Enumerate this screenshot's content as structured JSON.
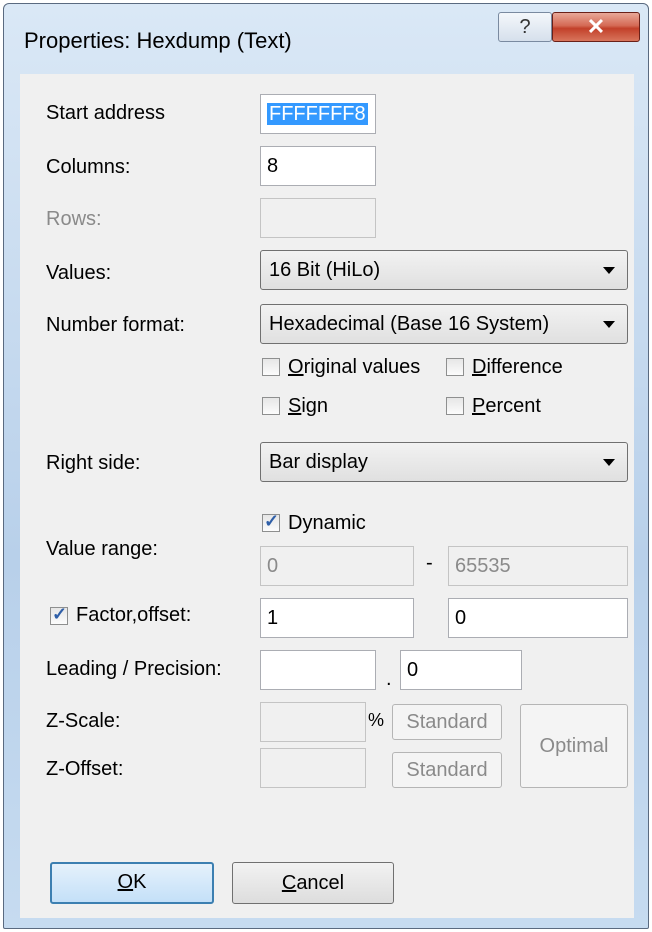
{
  "window": {
    "title": "Properties: Hexdump (Text)",
    "help_glyph": "?",
    "close_glyph": "✕"
  },
  "fields": {
    "start_address": {
      "label": "Start address",
      "value": "FFFFFFF8"
    },
    "columns": {
      "label": "Columns:",
      "value": "8"
    },
    "rows": {
      "label": "Rows:",
      "value": ""
    },
    "values": {
      "label": "Values:",
      "selected": "16 Bit (HiLo)"
    },
    "number_format": {
      "label": "Number format:",
      "selected": "Hexadecimal  (Base 16 System)"
    }
  },
  "checkboxes": {
    "original_values": {
      "hotkey": "O",
      "rest": "riginal values",
      "checked": false
    },
    "difference": {
      "hotkey": "D",
      "rest": "ifference",
      "checked": false
    },
    "sign": {
      "hotkey": "S",
      "rest": "ign",
      "checked": false
    },
    "percent": {
      "hotkey": "P",
      "rest": "ercent",
      "checked": false
    }
  },
  "right_side": {
    "label": "Right side:",
    "selected": "Bar display"
  },
  "value_range": {
    "label": "Value range:",
    "dynamic_label": "Dynamic",
    "dynamic_checked": true,
    "min": "0",
    "separator": "-",
    "max": "65535"
  },
  "factor_offset": {
    "label": "Factor,offset:",
    "checked": true,
    "factor": "1",
    "offset": "0"
  },
  "leading_precision": {
    "label": "Leading / Precision:",
    "leading": "",
    "separator": ".",
    "precision": "0"
  },
  "z_scale": {
    "label": "Z-Scale:",
    "value": "",
    "unit": "%",
    "standard_label": "Standard"
  },
  "z_offset": {
    "label": "Z-Offset:",
    "value": "",
    "standard_label": "Standard"
  },
  "optimal_label": "Optimal",
  "buttons": {
    "ok": {
      "hotkey": "O",
      "rest": "K"
    },
    "cancel": {
      "hotkey": "C",
      "rest": "ancel"
    }
  }
}
